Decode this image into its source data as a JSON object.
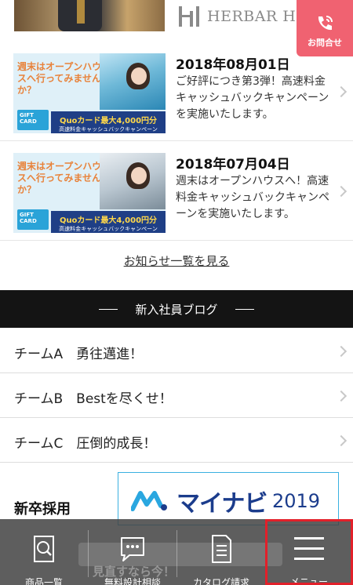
{
  "header": {
    "logo_text": "HERBAR HOUSE",
    "contact_label": "お問合せ"
  },
  "news": {
    "items": [
      {
        "date": "2018年08月01日",
        "body": "ご好評につき第3弾！高速料金キャッシュバックキャンペーンを実施いたします。",
        "thumb_text": "週末はオープンハウスへ行ってみませんか？",
        "thumb_band_main": "Quoカード最大4,000円分",
        "thumb_band_sub": "高速料金キャッシュバックキャンペーン",
        "gift_label": "GIFT CARD"
      },
      {
        "date": "2018年07月04日",
        "body": "週末はオープンハウスへ！高速料金キャッシュバックキャンペーンを実施いたします。",
        "thumb_text": "週末はオープンハウスへ行ってみませんか？",
        "thumb_band_main": "Quoカード最大4,000円分",
        "thumb_band_sub": "高速料金キャッシュバックキャンペーン",
        "gift_label": "GIFT CARD"
      }
    ],
    "more_link": "お知らせ一覧を見る"
  },
  "blog": {
    "title": "新入社員ブログ",
    "items": [
      {
        "label": "チームA　勇往邁進！"
      },
      {
        "label": "チームB　Bestを尽くせ！"
      },
      {
        "label": "チームC　圧倒的成長！"
      }
    ]
  },
  "recruit": {
    "title": "新卒採用",
    "banner_name": "マイナビ",
    "banner_year": "2019"
  },
  "bottom_nav": {
    "peek_text": "見直すなら今！",
    "items": [
      {
        "label": "商品一覧",
        "icon": "search-icon"
      },
      {
        "label": "無料設計相談",
        "icon": "chat-bubble-icon"
      },
      {
        "label": "カタログ請求",
        "icon": "document-icon"
      },
      {
        "label": "メニュー",
        "icon": "hamburger-icon"
      }
    ]
  },
  "colors": {
    "contact_bg": "#f06271",
    "blog_header_bg": "#141414",
    "nav_bg": "#444444",
    "highlight": "#e2202a",
    "mynavi_blue": "#1b3c8c"
  }
}
